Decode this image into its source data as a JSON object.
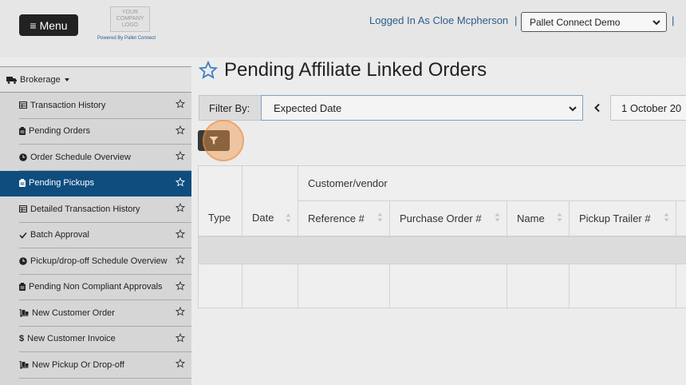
{
  "header": {
    "menu_label": "Menu",
    "logo_lines": [
      "YOUR",
      "COMPANY",
      "LOGO"
    ],
    "powered_by": "Powered By Pallet Connect",
    "logged_in": "Logged In As Cloe Mcpherson",
    "separator": "|",
    "account_selected": "Pallet Connect Demo"
  },
  "sidebar": {
    "section": "Brokerage",
    "items": [
      {
        "label": "Transaction History",
        "icon": "table-icon"
      },
      {
        "label": "Pending Orders",
        "icon": "clipboard-icon"
      },
      {
        "label": "Order Schedule Overview",
        "icon": "clock-icon"
      },
      {
        "label": "Pending Pickups",
        "icon": "clipboard-icon",
        "active": true
      },
      {
        "label": "Detailed Transaction History",
        "icon": "table-icon"
      },
      {
        "label": "Batch Approval",
        "icon": "check-icon"
      },
      {
        "label": "Pickup/drop-off Schedule Overview",
        "icon": "clock-icon"
      },
      {
        "label": "Pending Non Compliant Approvals",
        "icon": "clipboard-icon"
      },
      {
        "label": "New Customer Order",
        "icon": "dolly-icon"
      },
      {
        "label": "New Customer Invoice",
        "icon": "dollar-icon"
      },
      {
        "label": "New Pickup Or Drop-off",
        "icon": "dolly-icon"
      }
    ]
  },
  "main": {
    "title": "Pending Affiliate Linked Orders",
    "filter_label": "Filter By:",
    "filter_value": "Expected Date",
    "date_value": "1 October 20"
  },
  "table": {
    "group_header": "Customer/vendor",
    "columns": [
      "Type",
      "Date",
      "Reference #",
      "Purchase Order #",
      "Name",
      "Pickup Trailer #"
    ]
  },
  "colors": {
    "active_bg": "#0e4d7e",
    "link": "#2f5c8a",
    "star": "#3b7fc4",
    "highlight": "#f0964a"
  }
}
